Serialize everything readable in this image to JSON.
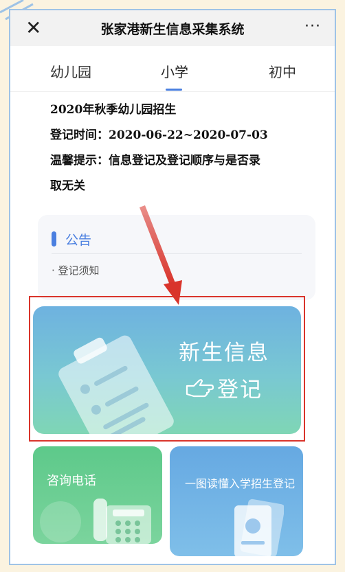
{
  "topbar": {
    "close_icon": "close-icon",
    "title": "张家港新生信息采集系统",
    "more_icon": "more-icon",
    "more_glyph": "···"
  },
  "tabs": [
    {
      "label": "幼儿园"
    },
    {
      "label": "小学",
      "active": true
    },
    {
      "label": "初中"
    }
  ],
  "info": {
    "heading": "2020年秋季幼儿园招生",
    "reg_time": "登记时间：2020-06-22~2020-07-03",
    "tip_line1": "温馨提示：信息登记及登记顺序与是否录",
    "tip_line2": "取无关"
  },
  "notice": {
    "title": "公告",
    "item": "· 登记须知"
  },
  "register_card": {
    "title": "新生信息",
    "action": "登记"
  },
  "phone_card": {
    "title": "咨询电话"
  },
  "guide_card": {
    "title": "一图读懂入学招生登记"
  },
  "colors": {
    "accent": "#4a7fe0",
    "highlight_border": "#d9342b",
    "page_bg": "#fbf3e0"
  }
}
